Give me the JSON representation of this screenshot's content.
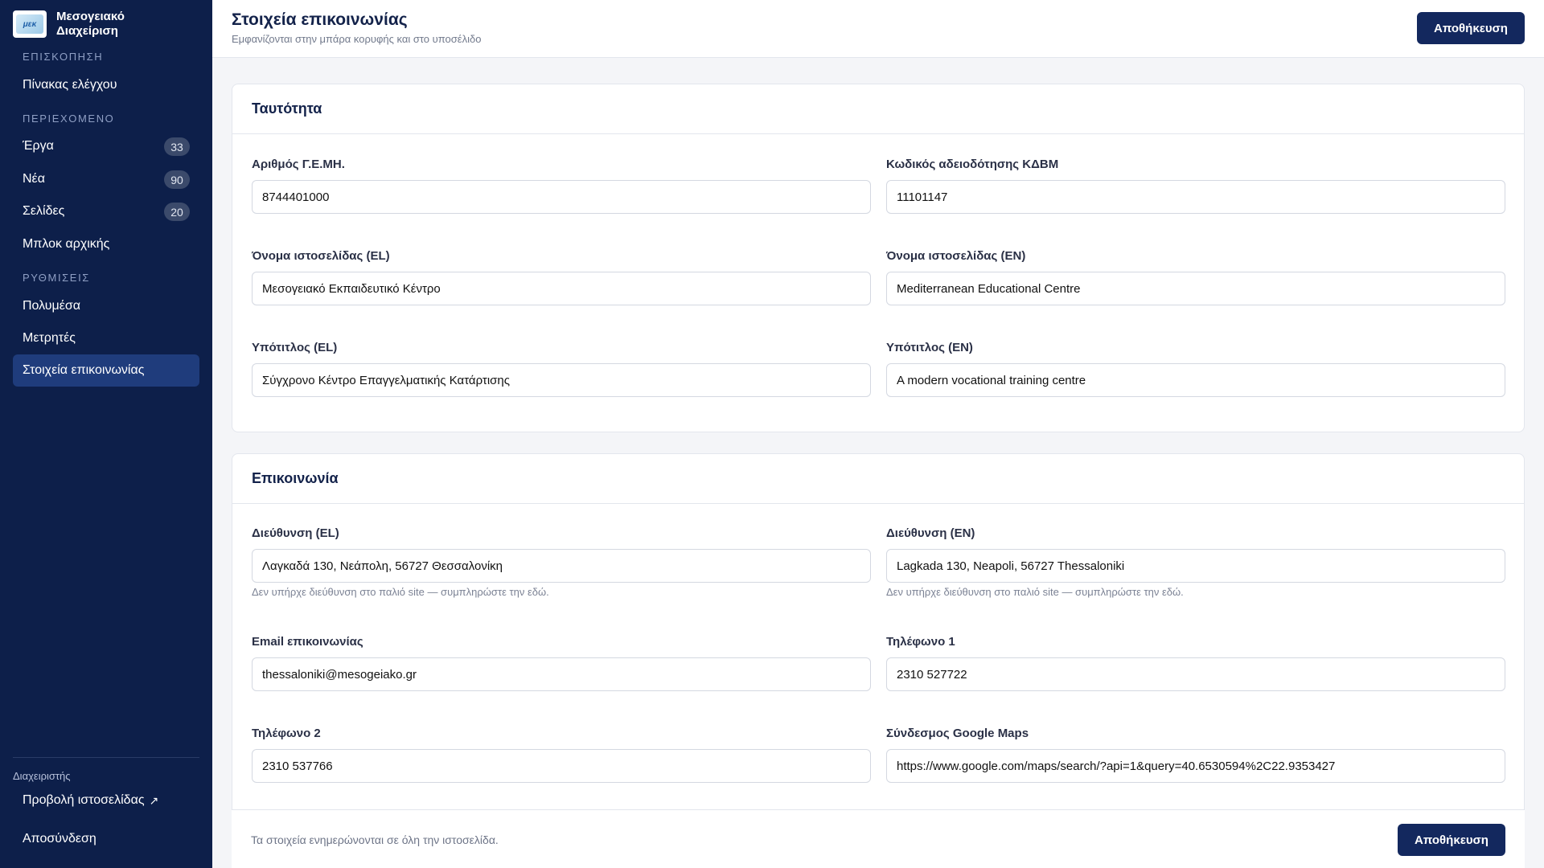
{
  "sidebar": {
    "brand_line1": "Μεσογειακό",
    "brand_line2": "Διαχείριση",
    "logo_text": "μεκ",
    "sections": [
      {
        "label": "ΕΠΙΣΚΟΠΗΣΗ"
      },
      {
        "label": "ΠΕΡΙΕΧΟΜΕΝΟ"
      },
      {
        "label": "ΡΥΘΜΙΣΕΙΣ"
      }
    ],
    "items": [
      {
        "label": "Πίνακας ελέγχου"
      },
      {
        "label": "Έργα",
        "count": "33"
      },
      {
        "label": "Νέα",
        "count": "90"
      },
      {
        "label": "Σελίδες",
        "count": "20"
      },
      {
        "label": "Μπλοκ αρχικής"
      },
      {
        "label": "Πολυμέσα"
      },
      {
        "label": "Μετρητές"
      },
      {
        "label": "Στοιχεία επικοινωνίας",
        "active": true
      }
    ],
    "admin_label": "Διαχειριστής",
    "view_site": "Προβολή ιστοσελίδας",
    "view_site_arrow": "↗",
    "logout": "Αποσύνδεση"
  },
  "header": {
    "title": "Στοιχεία επικοινωνίας",
    "subtitle": "Εμφανίζονται στην μπάρα κορυφής και στο υποσέλιδο",
    "save_label": "Αποθήκευση"
  },
  "identity": {
    "title": "Ταυτότητα",
    "gemi_label": "Αριθμός Γ.Ε.ΜΗ.",
    "gemi_value": "8744401000",
    "kdvm_label": "Κωδικός αδειοδότησης ΚΔΒΜ",
    "kdvm_value": "11101147",
    "name_el_label": "Όνομα ιστοσελίδας (EL)",
    "name_el_value": "Μεσογειακό Εκπαιδευτικό Κέντρο",
    "name_en_label": "Όνομα ιστοσελίδας (EN)",
    "name_en_value": "Mediterranean Educational Centre",
    "subtitle_el_label": "Υπότιτλος (EL)",
    "subtitle_el_value": "Σύγχρονο Κέντρο Επαγγελματικής Κατάρτισης",
    "subtitle_en_label": "Υπότιτλος (EN)",
    "subtitle_en_value": "A modern vocational training centre"
  },
  "contact": {
    "title": "Επικοινωνία",
    "address_el_label": "Διεύθυνση (EL)",
    "address_el_value": "Λαγκαδά 130, Νεάπολη, 56727 Θεσσαλονίκη",
    "address_en_label": "Διεύθυνση (EN)",
    "address_en_value": "Lagkada 130, Neapoli, 56727 Thessaloniki",
    "address_hint": "Δεν υπήρχε διεύθυνση στο παλιό site — συμπληρώστε την εδώ.",
    "email_label": "Email επικοινωνίας",
    "email_value": "thessaloniki@mesogeiako.gr",
    "phone1_label": "Τηλέφωνο 1",
    "phone1_value": "2310 527722",
    "phone2_label": "Τηλέφωνο 2",
    "phone2_value": "2310 537766",
    "maps_label": "Σύνδεσμος Google Maps",
    "maps_value": "https://www.google.com/maps/search/?api=1&query=40.6530594%2C22.9353427"
  },
  "footer": {
    "text": "Τα στοιχεία ενημερώνονται σε όλη την ιστοσελίδα.",
    "save_label": "Αποθήκευση"
  },
  "colors": {
    "sidebar_bg": "#0d1f4a",
    "sidebar_active": "#1f3c7c",
    "primary_button": "#13285e"
  }
}
